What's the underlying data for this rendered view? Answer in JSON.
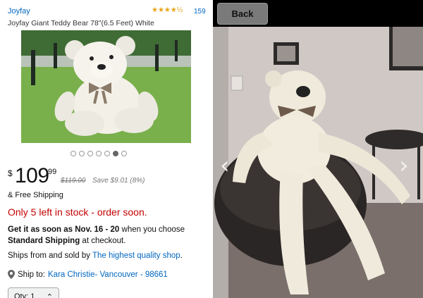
{
  "product": {
    "brand": "Joyfay",
    "stars": "★★★★½",
    "rating_count": "159",
    "title": "Joyfay Giant Teddy Bear 78\"(6.5 Feet) White",
    "carousel": {
      "count": 7,
      "active_index": 5
    }
  },
  "price": {
    "currency": "$",
    "whole": "109",
    "cents": "99",
    "list_price": "$119.00",
    "savings": "Save $9.01 (8%)"
  },
  "shipping": {
    "label": "& Free Shipping"
  },
  "stock": {
    "message": "Only 5 left in stock - order soon."
  },
  "delivery": {
    "prefix": "Get it as soon as ",
    "dates": "Nov. 16 - 20",
    "middle": " when you choose ",
    "method": "Standard Shipping",
    "suffix": " at checkout."
  },
  "seller": {
    "prefix": "Ships from and sold by ",
    "name": "The highest quality shop",
    "suffix": "."
  },
  "ship_to": {
    "label": "Ship to: ",
    "address": "Kara Christie- Vancouver - 98661"
  },
  "quantity": {
    "label": "Qty: 1",
    "arrows": "⌃"
  },
  "viewer": {
    "back_label": "Back",
    "prev_icon": "‹",
    "next_icon": "›"
  },
  "colors": {
    "link": "#0066c0",
    "stock_red": "#c40000",
    "star": "#e8a317"
  }
}
